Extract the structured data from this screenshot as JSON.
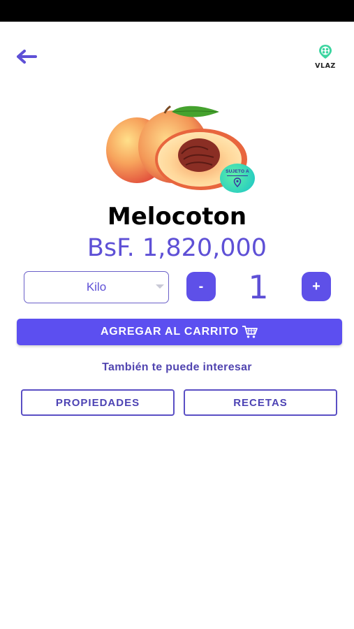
{
  "header": {
    "logo_text": "VLAZ",
    "back_icon": "arrow-left-icon",
    "logo_icon": "location-pin-logo-icon"
  },
  "product": {
    "image_name": "peach-image",
    "badge_text": "SUJETO A",
    "name": "Melocoton",
    "price": "BsF. 1,820,000"
  },
  "selector": {
    "unit_value": "Kilo",
    "minus_label": "-",
    "quantity": "1",
    "plus_label": "+"
  },
  "actions": {
    "add_to_cart_label": "AGREGAR AL CARRITO",
    "suggest_text": "También te puede interesar",
    "properties_label": "PROPIEDADES",
    "recipes_label": "RECETAS"
  },
  "colors": {
    "accent": "#5e50e8",
    "price": "#5e50d6",
    "outline": "#5a4fc4"
  }
}
